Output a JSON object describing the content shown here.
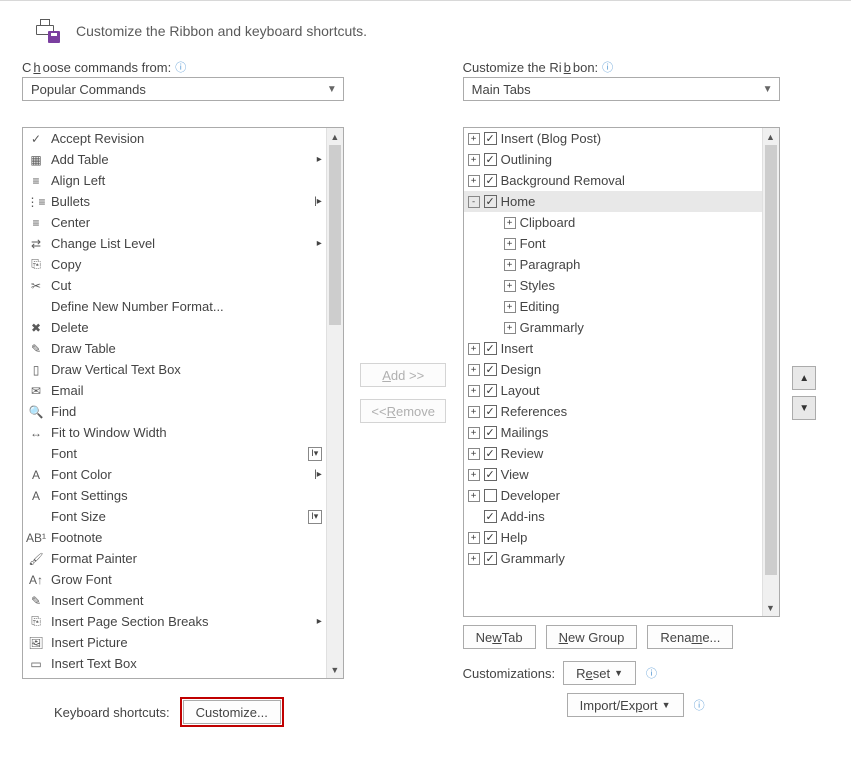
{
  "header": {
    "title": "Customize the Ribbon and keyboard shortcuts."
  },
  "left": {
    "label_pre": "C",
    "label_u": "h",
    "label_post": "oose commands from:",
    "dropdown": "Popular Commands",
    "items": [
      {
        "icon": "✓",
        "label": "Accept Revision"
      },
      {
        "icon": "▦",
        "label": "Add Table",
        "sub": "▸"
      },
      {
        "icon": "≡",
        "label": "Align Left"
      },
      {
        "icon": "⋮≡",
        "label": "Bullets",
        "sub": "|▸"
      },
      {
        "icon": "≡",
        "label": "Center"
      },
      {
        "icon": "⇄",
        "label": "Change List Level",
        "sub": "▸"
      },
      {
        "icon": "⎘",
        "label": "Copy"
      },
      {
        "icon": "✂",
        "label": "Cut"
      },
      {
        "icon": "",
        "label": "Define New Number Format..."
      },
      {
        "icon": "✖",
        "label": "Delete"
      },
      {
        "icon": "✎",
        "label": "Draw Table"
      },
      {
        "icon": "▯",
        "label": "Draw Vertical Text Box"
      },
      {
        "icon": "✉",
        "label": "Email"
      },
      {
        "icon": "🔍",
        "label": "Find"
      },
      {
        "icon": "↔",
        "label": "Fit to Window Width"
      },
      {
        "icon": "",
        "label": "Font",
        "sub": "I▾"
      },
      {
        "icon": "A",
        "label": "Font Color",
        "sub": "|▸"
      },
      {
        "icon": "A",
        "label": "Font Settings"
      },
      {
        "icon": "",
        "label": "Font Size",
        "sub": "I▾"
      },
      {
        "icon": "AB¹",
        "label": "Footnote"
      },
      {
        "icon": "🖌",
        "label": "Format Painter"
      },
      {
        "icon": "A↑",
        "label": "Grow Font"
      },
      {
        "icon": "✎",
        "label": "Insert Comment"
      },
      {
        "icon": "⎘",
        "label": "Insert Page  Section Breaks",
        "sub": "▸"
      },
      {
        "icon": "🖼",
        "label": "Insert Picture"
      },
      {
        "icon": "▭",
        "label": "Insert Text Box"
      }
    ]
  },
  "mid": {
    "add_pre": "",
    "add_u": "A",
    "add_post": "dd >>",
    "rem_pre": "<< ",
    "rem_u": "R",
    "rem_post": "emove"
  },
  "right": {
    "label_pre": "Customize the Ri",
    "label_u": "b",
    "label_post": "bon:",
    "dropdown": "Main Tabs",
    "tree": [
      {
        "toggle": "+",
        "checked": true,
        "label": "Insert (Blog Post)",
        "indent": 0
      },
      {
        "toggle": "+",
        "checked": true,
        "label": "Outlining",
        "indent": 0
      },
      {
        "toggle": "+",
        "checked": true,
        "label": "Background Removal",
        "indent": 0
      },
      {
        "toggle": "-",
        "checked": true,
        "label": "Home",
        "indent": 0,
        "selected": true
      },
      {
        "toggle": "+",
        "label": "Clipboard",
        "indent": 1
      },
      {
        "toggle": "+",
        "label": "Font",
        "indent": 1
      },
      {
        "toggle": "+",
        "label": "Paragraph",
        "indent": 1
      },
      {
        "toggle": "+",
        "label": "Styles",
        "indent": 1
      },
      {
        "toggle": "+",
        "label": "Editing",
        "indent": 1
      },
      {
        "toggle": "+",
        "label": "Grammarly",
        "indent": 1
      },
      {
        "toggle": "+",
        "checked": true,
        "label": "Insert",
        "indent": 0
      },
      {
        "toggle": "+",
        "checked": true,
        "label": "Design",
        "indent": 0
      },
      {
        "toggle": "+",
        "checked": true,
        "label": "Layout",
        "indent": 0
      },
      {
        "toggle": "+",
        "checked": true,
        "label": "References",
        "indent": 0
      },
      {
        "toggle": "+",
        "checked": true,
        "label": "Mailings",
        "indent": 0
      },
      {
        "toggle": "+",
        "checked": true,
        "label": "Review",
        "indent": 0
      },
      {
        "toggle": "+",
        "checked": true,
        "label": "View",
        "indent": 0
      },
      {
        "toggle": "+",
        "checked": false,
        "label": "Developer",
        "indent": 0
      },
      {
        "toggle": "",
        "checked": true,
        "label": "Add-ins",
        "indent": 0,
        "notoggle": true
      },
      {
        "toggle": "+",
        "checked": true,
        "label": "Help",
        "indent": 0
      },
      {
        "toggle": "+",
        "checked": true,
        "label": "Grammarly",
        "indent": 0
      }
    ]
  },
  "buttons": {
    "newtab_pre": "Ne",
    "newtab_u": "w",
    "newtab_post": " Tab",
    "newgroup_pre": "",
    "newgroup_u": "N",
    "newgroup_post": "ew Group",
    "rename_pre": "Rena",
    "rename_u": "m",
    "rename_post": "e...",
    "custom_label": "Customizations:",
    "reset_pre": "R",
    "reset_u": "e",
    "reset_post": "set",
    "importexport_pre": "Import/Ex",
    "importexport_u": "p",
    "importexport_post": "ort"
  },
  "footer": {
    "label": "Keyboard shortcuts:",
    "button": "Customize..."
  }
}
